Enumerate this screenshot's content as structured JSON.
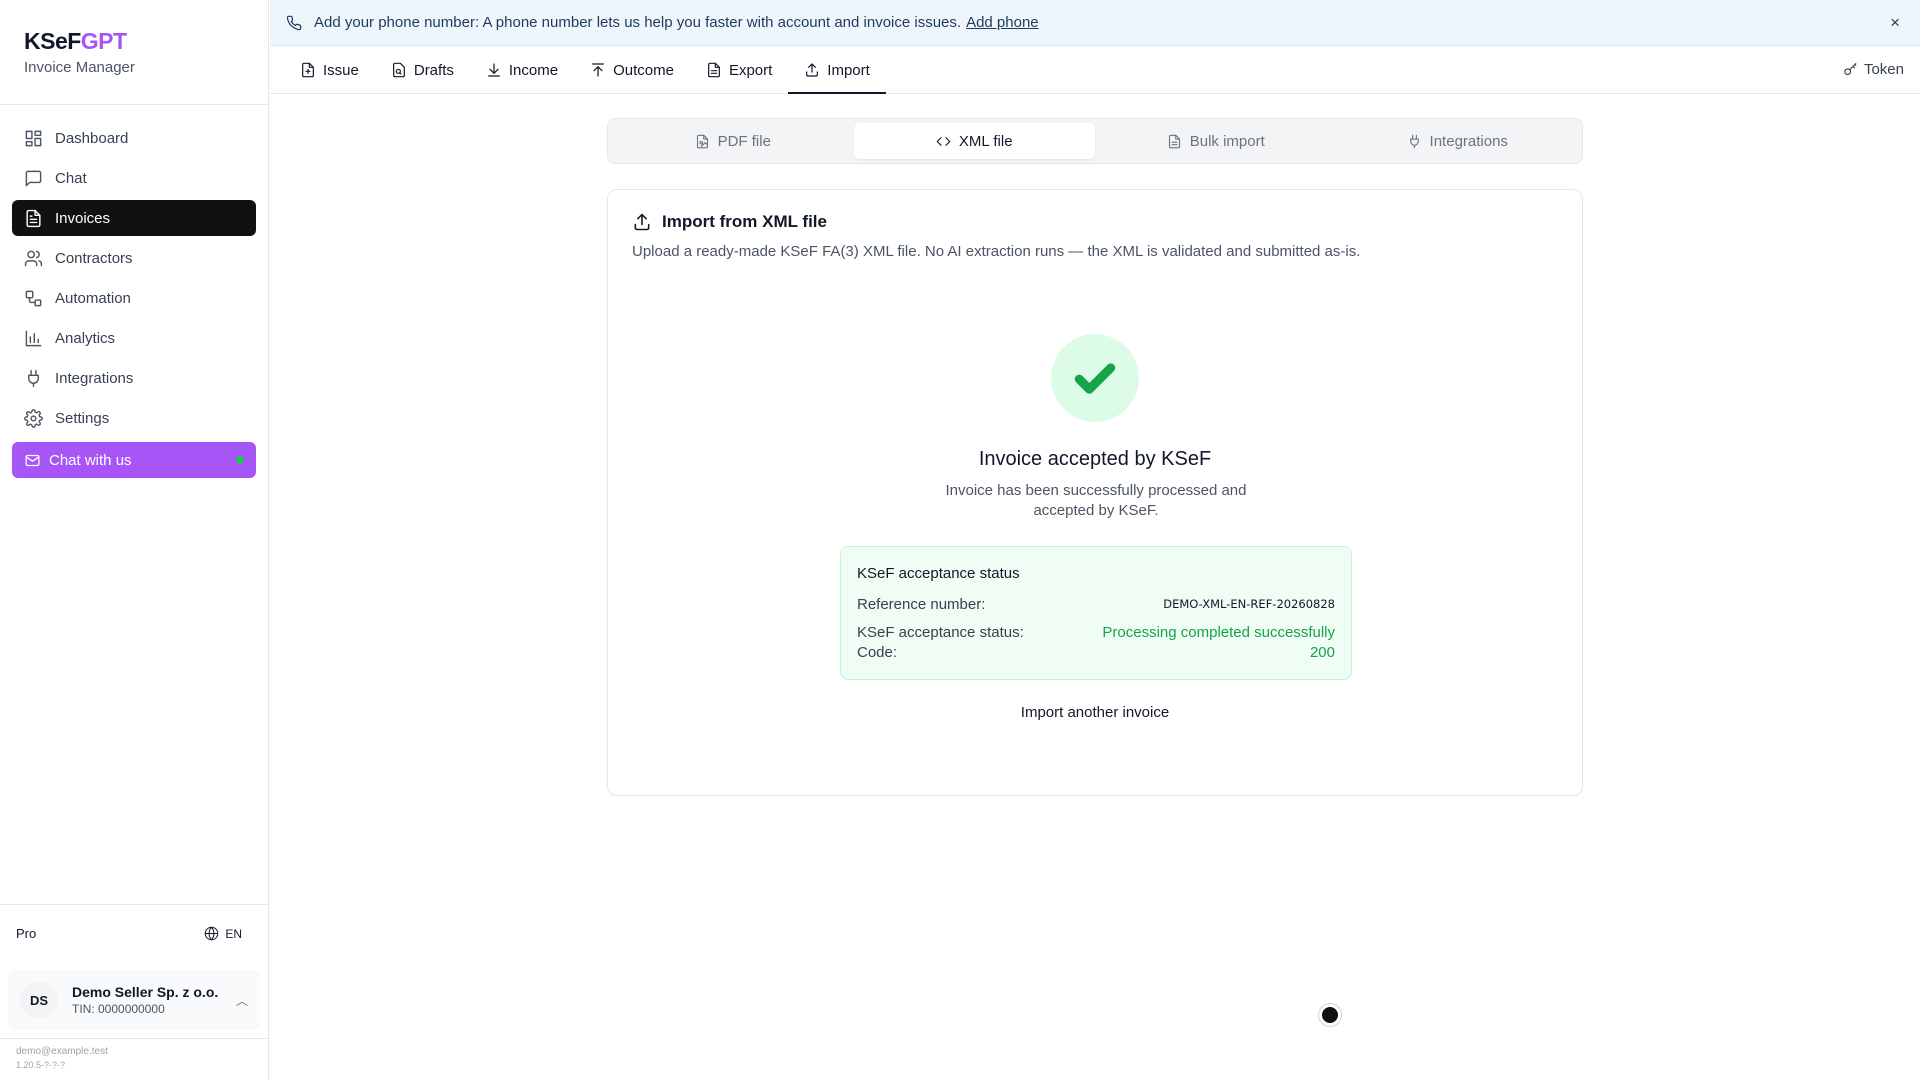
{
  "brand": {
    "name_main": "KSeF",
    "name_accent": "GPT",
    "subtitle": "Invoice Manager",
    "accent_color": "#a855f7"
  },
  "sidebar": {
    "items": [
      {
        "label": "Dashboard",
        "icon": "dashboard-icon",
        "active": false
      },
      {
        "label": "Chat",
        "icon": "chat-icon",
        "active": false
      },
      {
        "label": "Invoices",
        "icon": "invoice-icon",
        "active": true
      },
      {
        "label": "Contractors",
        "icon": "users-icon",
        "active": false
      },
      {
        "label": "Automation",
        "icon": "automation-icon",
        "active": false
      },
      {
        "label": "Analytics",
        "icon": "analytics-icon",
        "active": false
      },
      {
        "label": "Integrations",
        "icon": "plug-icon",
        "active": false
      },
      {
        "label": "Settings",
        "icon": "gear-icon",
        "active": false
      }
    ],
    "chat_button": "Chat with us",
    "plan": "Pro",
    "language": "EN",
    "account": {
      "initials": "DS",
      "name": "Demo Seller Sp. z o.o.",
      "tin": "TIN: 0000000000"
    },
    "email": "demo@example.test",
    "version": "1.20.5-?-?-?"
  },
  "banner": {
    "text": "Add your phone number: A phone number lets us help you faster with account and invoice issues.",
    "link": "Add phone",
    "close": "×"
  },
  "topnav": {
    "items": [
      {
        "label": "Issue",
        "icon": "file-plus-icon"
      },
      {
        "label": "Drafts",
        "icon": "drafts-icon"
      },
      {
        "label": "Income",
        "icon": "download-icon"
      },
      {
        "label": "Outcome",
        "icon": "upload-icon"
      },
      {
        "label": "Export",
        "icon": "document-icon"
      },
      {
        "label": "Import",
        "icon": "upload-icon",
        "active": true
      }
    ],
    "token": "Token"
  },
  "subtabs": [
    {
      "label": "PDF file",
      "icon": "pdf-icon"
    },
    {
      "label": "XML file",
      "icon": "code-icon",
      "active": true
    },
    {
      "label": "Bulk import",
      "icon": "files-icon"
    },
    {
      "label": "Integrations",
      "icon": "plug-icon"
    }
  ],
  "card": {
    "title": "Import from XML file",
    "description": "Upload a ready-made KSeF FA(3) XML file. No AI extraction runs — the XML is validated and submitted as-is.",
    "result_title": "Invoice accepted by KSeF",
    "result_desc": "Invoice has been successfully processed and accepted by KSeF.",
    "status": {
      "title": "KSeF acceptance status",
      "reference_label": "Reference number:",
      "reference_value": "DEMO-XML-EN-REF-20260828",
      "acceptance_label": "KSeF acceptance status:",
      "acceptance_value": "Processing completed successfully",
      "code_label": "Code:",
      "code_value": "200",
      "success_color": "#16a34a"
    },
    "import_another": "Import another invoice"
  }
}
